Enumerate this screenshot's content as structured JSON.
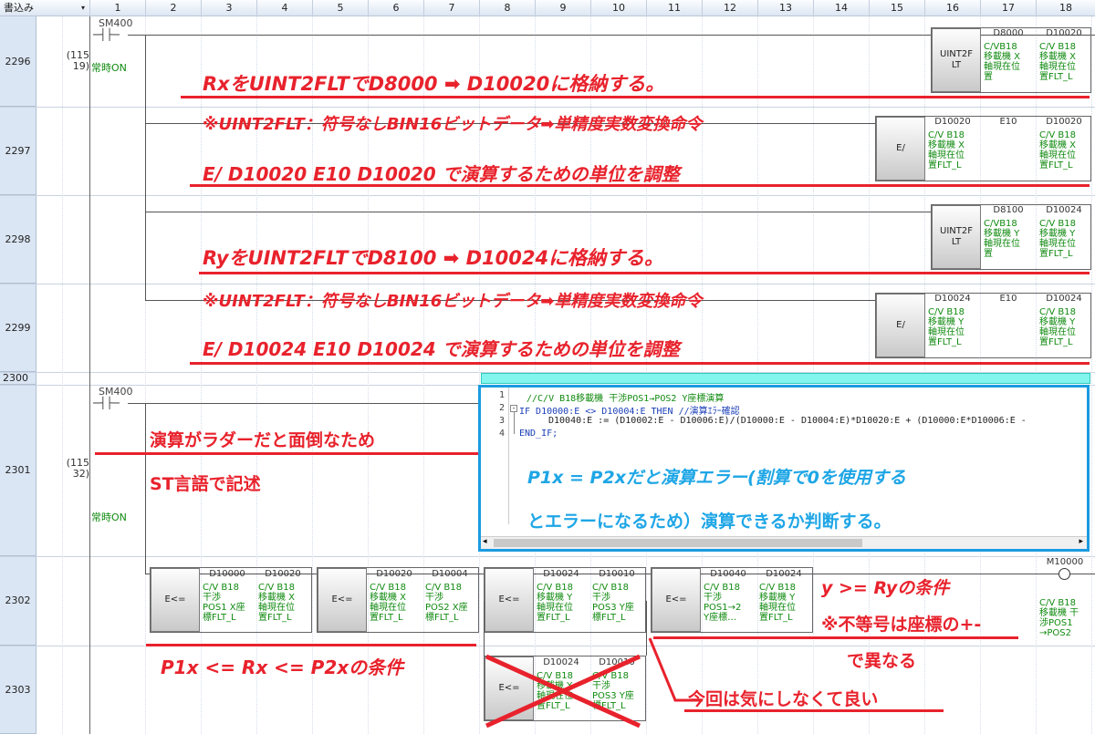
{
  "header": {
    "corner": "書込み",
    "cols": [
      "1",
      "2",
      "3",
      "4",
      "5",
      "6",
      "7",
      "8",
      "9",
      "10",
      "11",
      "12",
      "13",
      "14",
      "15",
      "16",
      "17",
      "18"
    ]
  },
  "rows": [
    "2296",
    "2297",
    "2298",
    "2299",
    "2300",
    "2301",
    "2302",
    "2303"
  ],
  "steps": {
    "r2296": "(115\n19)",
    "r2301": "(115\n32)"
  },
  "contacts": {
    "c1": "SM400",
    "c2": "SM400"
  },
  "comments": {
    "c1": "常時ON",
    "c2": "常時ON"
  },
  "instructions": {
    "i2296": {
      "name": "UINT2FLT",
      "op1": "D8000",
      "op2": "D10020",
      "c1": "C/VB18\n移載機 X\n軸現在位\n置",
      "c2": "C/V B18\n移載機 X\n軸現在位\n置FLT_L"
    },
    "i2297": {
      "name": "E/",
      "op1": "D10020",
      "op2": "E10",
      "op3": "D10020",
      "c1": "C/V B18\n移載機 X\n軸現在位\n置FLT_L",
      "c3": "C/V B18\n移載機 X\n軸現在位\n置FLT_L"
    },
    "i2298": {
      "name": "UINT2FLT",
      "op1": "D8100",
      "op2": "D10024",
      "c1": "C/VB18\n移載機 Y\n軸現在位\n置",
      "c2": "C/V B18\n移載機 Y\n軸現在位\n置FLT_L"
    },
    "i2299": {
      "name": "E/",
      "op1": "D10024",
      "op2": "E10",
      "op3": "D10024",
      "c1": "C/V B18\n移載機 Y\n軸現在位\n置FLT_L",
      "c3": "C/V B18\n移載機 Y\n軸現在位\n置FLT_L"
    },
    "i2302a": {
      "name": "E<=",
      "op1": "D10000",
      "op2": "D10020",
      "c1": "C/V B18\n干渉\nPOS1 X座\n標FLT_L",
      "c2": "C/V B18\n移載機 X\n軸現在位\n置FLT_L"
    },
    "i2302b": {
      "name": "E<=",
      "op1": "D10020",
      "op2": "D10004",
      "c1": "C/V B18\n移載機 X\n軸現在位\n置FLT_L",
      "c2": "C/V B18\n干渉\nPOS2 X座\n標FLT_L"
    },
    "i2302c": {
      "name": "E<=",
      "op1": "D10024",
      "op2": "D10010",
      "c1": "C/V B18\n移載機 Y\n軸現在位\n置FLT_L",
      "c2": "C/V B18\n干渉\nPOS3 Y座\n標FLT_L"
    },
    "i2302d": {
      "name": "E<=",
      "op1": "D10040",
      "op2": "D10024",
      "c1": "C/V B18\n干渉\nPOS1→2\nY座標…",
      "c2": "C/V B18\n移載機 Y\n軸現在位\n置FLT_L"
    },
    "i2303": {
      "name": "E<=",
      "op1": "D10024",
      "op2": "D10010",
      "c1": "C/V B18\n移載機 Y\n軸現在位\n置FLT_L",
      "c2": "C/V B18\n干渉\nPOS3 Y座\n標FLT_L"
    }
  },
  "coil": {
    "name": "M10000",
    "comment": "C/V B18\n移載機 干\n渉POS1\n→POS2"
  },
  "st_code": {
    "n1": "1",
    "l1": "//C/V B18移載機 干渉POS1→POS2 Y座標演算",
    "n2": "2",
    "l2": "IF D10000:E <> D10004:E THEN //演算ｴﾗｰ確認",
    "n3": "3",
    "l3": "D10040:E := (D10002:E - D10006:E)/(D10000:E - D10004:E)*D10020:E + (D10000:E*D10006:E -",
    "n4": "4",
    "l4": "END_IF;"
  },
  "annotations": {
    "a1": "RxをUINT2FLTでD8000 ➡ D10020に格納する。",
    "a2": "※UINT2FLT：符号なしBIN16ビットデータ➡単精度実数変換命令",
    "a3": "E/ D10020 E10 D10020 で演算するための単位を調整",
    "a4": "RyをUINT2FLTでD8100 ➡ D10024に格納する。",
    "a5": "※UINT2FLT：符号なしBIN16ビットデータ➡単精度実数変換命令",
    "a6": "E/ D10024 E10 D10024 で演算するための単位を調整",
    "a7": "演算がラダーだと面倒なため",
    "a8": "ST言語で記述",
    "a9": "P1x = P2xだと演算エラー(割算で0を使用する",
    "a10": "とエラーになるため）演算できるか判断する。",
    "a11": "y >= Ryの条件",
    "a12": "※不等号は座標の+-",
    "a13": "で異なる",
    "a14": "P1x <= Rx <= P2xの条件",
    "a15": "今回は気にしなくて良い"
  },
  "colors": {
    "red": "#e8222c",
    "blue": "#1ea6e6",
    "green": "#108a10",
    "cyan": "#82f5ec"
  }
}
